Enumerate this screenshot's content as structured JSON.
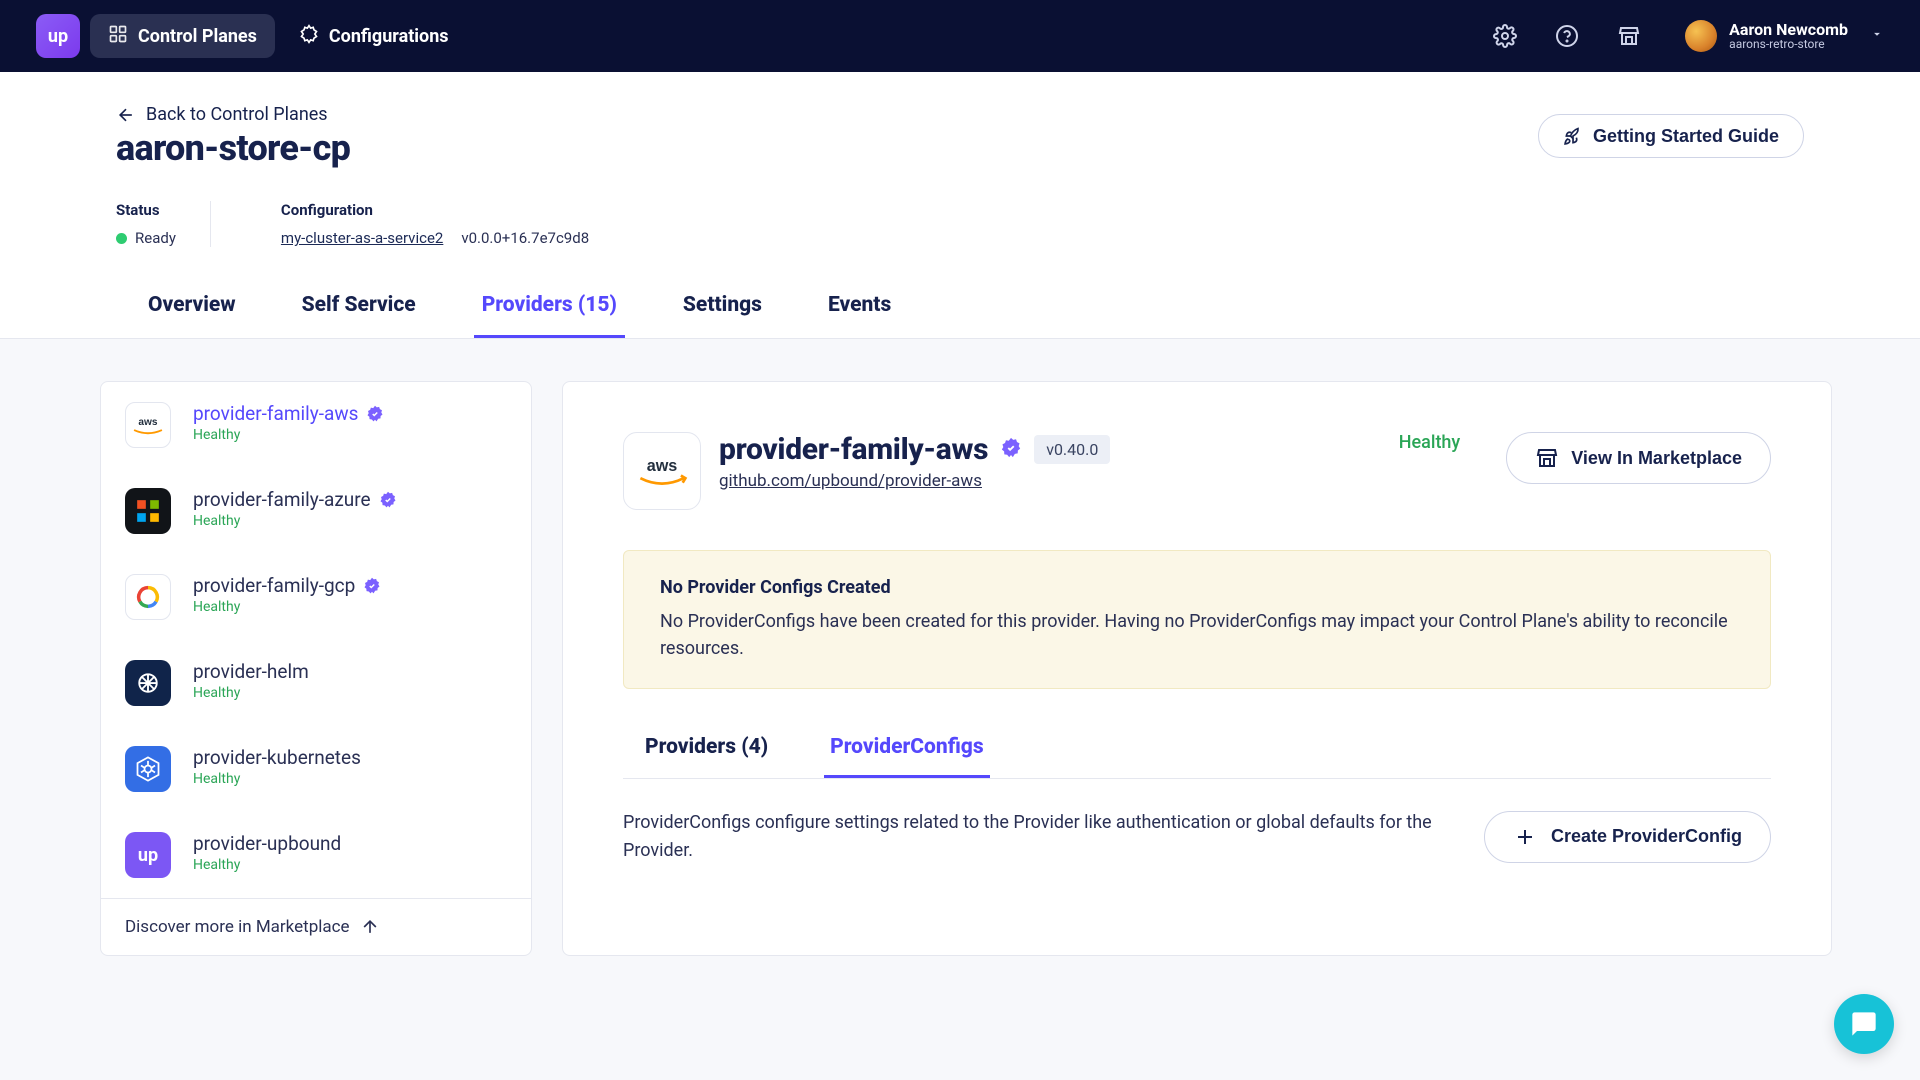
{
  "nav": {
    "logo_text": "up",
    "control_planes": "Control Planes",
    "configurations": "Configurations",
    "user_name": "Aaron Newcomb",
    "user_org": "aarons-retro-store"
  },
  "back": "Back to Control Planes",
  "page_title": "aaron-store-cp",
  "getting_started": "Getting Started Guide",
  "meta": {
    "status_label": "Status",
    "status_value": "Ready",
    "config_label": "Configuration",
    "config_name": "my-cluster-as-a-service2",
    "config_version": "v0.0.0+16.7e7c9d8"
  },
  "tabs": {
    "overview": "Overview",
    "self_service": "Self Service",
    "providers": "Providers (15)",
    "settings": "Settings",
    "events": "Events"
  },
  "providers": [
    {
      "name": "provider-family-aws",
      "health": "Healthy",
      "verified": true,
      "selected": true,
      "icon": "aws"
    },
    {
      "name": "provider-family-azure",
      "health": "Healthy",
      "verified": true,
      "selected": false,
      "icon": "azure"
    },
    {
      "name": "provider-family-gcp",
      "health": "Healthy",
      "verified": true,
      "selected": false,
      "icon": "gcp"
    },
    {
      "name": "provider-helm",
      "health": "Healthy",
      "verified": false,
      "selected": false,
      "icon": "helm"
    },
    {
      "name": "provider-kubernetes",
      "health": "Healthy",
      "verified": false,
      "selected": false,
      "icon": "kube"
    },
    {
      "name": "provider-upbound",
      "health": "Healthy",
      "verified": false,
      "selected": false,
      "icon": "up"
    }
  ],
  "marketplace_link": "Discover more in Marketplace",
  "detail": {
    "title": "provider-family-aws",
    "version": "v0.40.0",
    "repo": "github.com/upbound/provider-aws",
    "healthy": "Healthy",
    "view_marketplace": "View In Marketplace",
    "warning_title": "No Provider Configs Created",
    "warning_body": "No ProviderConfigs have been created for this provider. Having no ProviderConfigs may impact your Control Plane's ability to reconcile resources.",
    "inner_tabs": {
      "providers": "Providers (4)",
      "configs": "ProviderConfigs"
    },
    "pc_desc": "ProviderConfigs configure settings related to the Provider like authentication or global defaults for the Provider.",
    "create_pc": "Create ProviderConfig"
  }
}
